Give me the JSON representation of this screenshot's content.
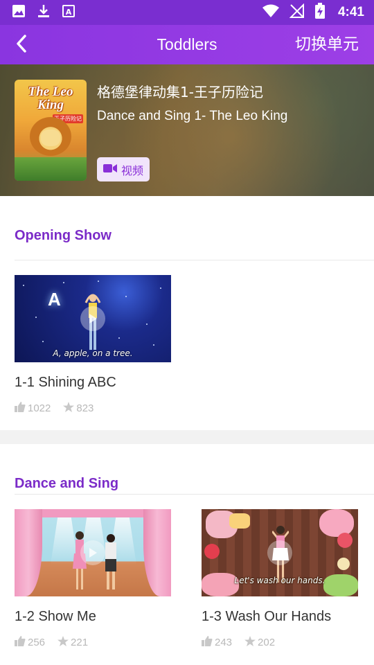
{
  "status_bar": {
    "time": "4:41",
    "left_icons": [
      "image-icon",
      "download-icon",
      "accessibility-icon"
    ],
    "right_icons": [
      "wifi-icon",
      "no-signal-icon",
      "battery-charging-icon"
    ]
  },
  "header": {
    "title": "Toddlers",
    "switch_label": "切换单元",
    "back_icon": "chevron-left-icon"
  },
  "hero": {
    "title_cn": "格德堡律动集1-王子历险记",
    "title_en": "Dance and Sing 1- The Leo King",
    "video_chip_label": "视频",
    "cover_title": "The Leo King",
    "cover_tag": "王子历险记"
  },
  "sections": [
    {
      "title": "Opening Show",
      "items": [
        {
          "title": "1-1 Shining ABC",
          "likes": "1022",
          "stars": "823",
          "thumb_caption": "A, apple, on a tree.",
          "thumb_letter": "A"
        }
      ]
    },
    {
      "title": "Dance and Sing",
      "items": [
        {
          "title": "1-2 Show Me",
          "likes": "256",
          "stars": "221"
        },
        {
          "title": "1-3 Wash Our Hands",
          "likes": "243",
          "stars": "202",
          "thumb_caption": "Let's wash our hands."
        }
      ]
    }
  ],
  "colors": {
    "accent": "#8a35e0",
    "status_bar": "#7a2ed0",
    "section_title": "#7b2bc8",
    "stat_gray": "#b8b8b8"
  }
}
